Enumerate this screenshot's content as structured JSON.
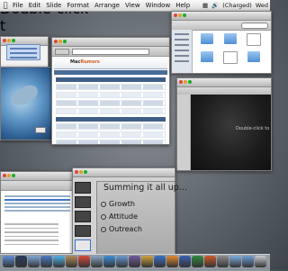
{
  "menubar": {
    "apple_icon": "apple-icon",
    "items": [
      "File",
      "Edit",
      "Slide",
      "Format",
      "Arrange",
      "View",
      "Window",
      "Help"
    ],
    "status": {
      "battery": "(Charged)",
      "day": "Wed"
    }
  },
  "keynote": {
    "placeholder_title": "Double-click t",
    "placeholder_sub": "Double-click to"
  },
  "browser": {
    "site_name_plain": "Mac",
    "site_name_accent": "Rumors"
  },
  "summary_slide": {
    "title": "Summing it all up...",
    "bullets": [
      "Growth",
      "Attitude",
      "Outreach"
    ]
  },
  "dock": {
    "icons": [
      {
        "name": "finder-icon",
        "color": "#5b8fd6"
      },
      {
        "name": "dashboard-icon",
        "color": "#2b3a5a"
      },
      {
        "name": "mail-icon",
        "color": "#7fa8d8"
      },
      {
        "name": "safari-icon",
        "color": "#4a7cc0"
      },
      {
        "name": "ichat-icon",
        "color": "#4fb3e8"
      },
      {
        "name": "addressbook-icon",
        "color": "#b08a5a"
      },
      {
        "name": "ical-icon",
        "color": "#d94a3a"
      },
      {
        "name": "preview-icon",
        "color": "#8aa6c2"
      },
      {
        "name": "itunes-icon",
        "color": "#3c8fd8"
      },
      {
        "name": "iphoto-icon",
        "color": "#6a9ad0"
      },
      {
        "name": "imovie-icon",
        "color": "#6f5b9c"
      },
      {
        "name": "garageband-icon",
        "color": "#d0a43a"
      },
      {
        "name": "keynote-icon",
        "color": "#3b6fc4"
      },
      {
        "name": "pages-icon",
        "color": "#e08a2a"
      },
      {
        "name": "word-icon",
        "color": "#3b5fb0"
      },
      {
        "name": "excel-icon",
        "color": "#2f8a3c"
      },
      {
        "name": "powerpoint-icon",
        "color": "#cc5a2a"
      },
      {
        "name": "system-prefs-icon",
        "color": "#8c8c8c"
      },
      {
        "name": "folder-icon",
        "color": "#7eaee0"
      },
      {
        "name": "downloads-icon",
        "color": "#6ea0d8"
      },
      {
        "name": "trash-icon",
        "color": "#c9cdd2"
      }
    ]
  }
}
